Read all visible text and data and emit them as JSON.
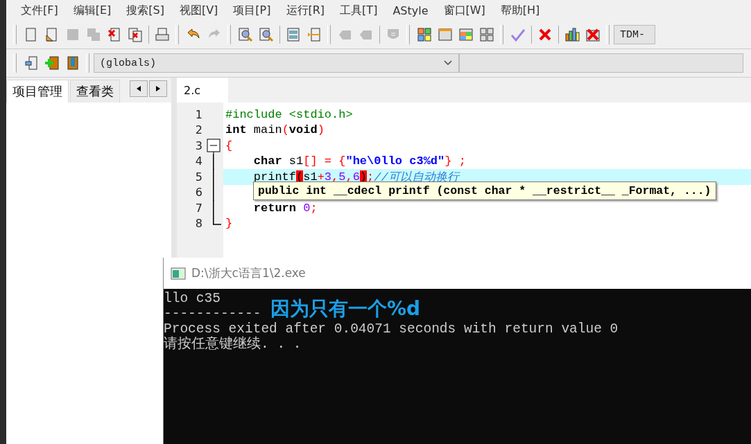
{
  "menu": [
    "文件[F]",
    "编辑[E]",
    "搜索[S]",
    "视图[V]",
    "项目[P]",
    "运行[R]",
    "工具[T]",
    "AStyle",
    "窗口[W]",
    "帮助[H]"
  ],
  "toolbar_1": {
    "groups": [
      [
        {
          "disabled": false
        },
        {
          "disabled": false
        },
        {
          "disabled": true
        },
        {
          "disabled": true
        },
        {
          "disabled": false
        },
        {
          "disabled": false
        }
      ],
      [
        {
          "disabled": false
        }
      ],
      [
        {
          "disabled": false
        },
        {
          "disabled": true
        }
      ],
      [
        {
          "disabled": false
        },
        {
          "disabled": false
        }
      ],
      [
        {
          "disabled": false
        },
        {
          "disabled": false
        }
      ],
      [
        {
          "disabled": true
        },
        {
          "disabled": true
        }
      ],
      [
        {
          "disabled": true
        }
      ],
      [
        {
          "disabled": false
        },
        {
          "disabled": false
        },
        {
          "disabled": false
        },
        {
          "disabled": false
        }
      ],
      [
        {
          "disabled": false
        }
      ],
      [
        {
          "disabled": false
        }
      ],
      [
        {
          "disabled": false
        },
        {
          "disabled": false
        }
      ]
    ],
    "compiler": "TDM-"
  },
  "toolbar_2": {
    "buttons": [
      {
        "disabled": false
      },
      {
        "disabled": false
      },
      {
        "disabled": false
      }
    ],
    "scope": "(globals)"
  },
  "left_tabs": [
    {
      "label": "项目管理",
      "selected": true
    },
    {
      "label": "查看类",
      "selected": false
    }
  ],
  "editor_tabs": [
    {
      "label": "2.c",
      "selected": true
    }
  ],
  "code": [
    {
      "number": "1",
      "kind": "plain",
      "highlighted": false,
      "tokens": [
        {
          "kind": "preproc",
          "text": "#include <stdio.h>"
        }
      ]
    },
    {
      "number": "2",
      "kind": "plain",
      "highlighted": false,
      "tokens": [
        {
          "kind": "keyword",
          "text": "int"
        },
        {
          "kind": "ident",
          "text": " main"
        },
        {
          "kind": "op",
          "text": "("
        },
        {
          "kind": "keyword",
          "text": "void"
        },
        {
          "kind": "op",
          "text": ")"
        }
      ]
    },
    {
      "number": "3",
      "kind": "foldstart",
      "highlighted": false,
      "tokens": [
        {
          "kind": "op",
          "text": "{"
        }
      ]
    },
    {
      "number": "4",
      "kind": "foldbody",
      "highlighted": false,
      "tokens": [
        {
          "kind": "keyword",
          "text": "    char"
        },
        {
          "kind": "ident",
          "text": " s1"
        },
        {
          "kind": "op",
          "text": "[] = {"
        },
        {
          "kind": "string",
          "text": "\"he\\0llo c3%d\""
        },
        {
          "kind": "op",
          "text": "} ;"
        }
      ]
    },
    {
      "number": "5",
      "kind": "foldbody",
      "highlighted": true,
      "tokens": [
        {
          "kind": "ident",
          "text": "    printf"
        },
        {
          "kind": "brace",
          "text": "("
        },
        {
          "kind": "ident",
          "text": "s1"
        },
        {
          "kind": "op",
          "text": "+"
        },
        {
          "kind": "number",
          "text": "3"
        },
        {
          "kind": "op",
          "text": ","
        },
        {
          "kind": "number",
          "text": "5"
        },
        {
          "kind": "op",
          "text": ","
        },
        {
          "kind": "number",
          "text": "6"
        },
        {
          "kind": "brace",
          "text": ")"
        },
        {
          "kind": "op",
          "text": ";"
        },
        {
          "kind": "comment",
          "text": "//可以自动换行"
        }
      ]
    },
    {
      "number": "6",
      "kind": "foldbody",
      "highlighted": false
    },
    {
      "number": "7",
      "kind": "foldbody",
      "highlighted": false,
      "tokens": [
        {
          "kind": "keyword",
          "text": "    return"
        },
        {
          "kind": "number",
          "text": " 0"
        },
        {
          "kind": "op",
          "text": ";"
        }
      ]
    },
    {
      "number": "8",
      "kind": "foldend",
      "highlighted": false,
      "tokens": [
        {
          "kind": "op",
          "text": "}"
        }
      ]
    }
  ],
  "tooltip": "public int __cdecl printf (const char * __restrict__ _Format, ...)",
  "console": {
    "title": "D:\\浙大c语言1\\2.exe",
    "lines": [
      "llo c35",
      "------------",
      "Process exited after 0.04071 seconds with return value 0",
      "请按任意键继续. . ."
    ]
  },
  "annotation": "因为只有一个%d"
}
